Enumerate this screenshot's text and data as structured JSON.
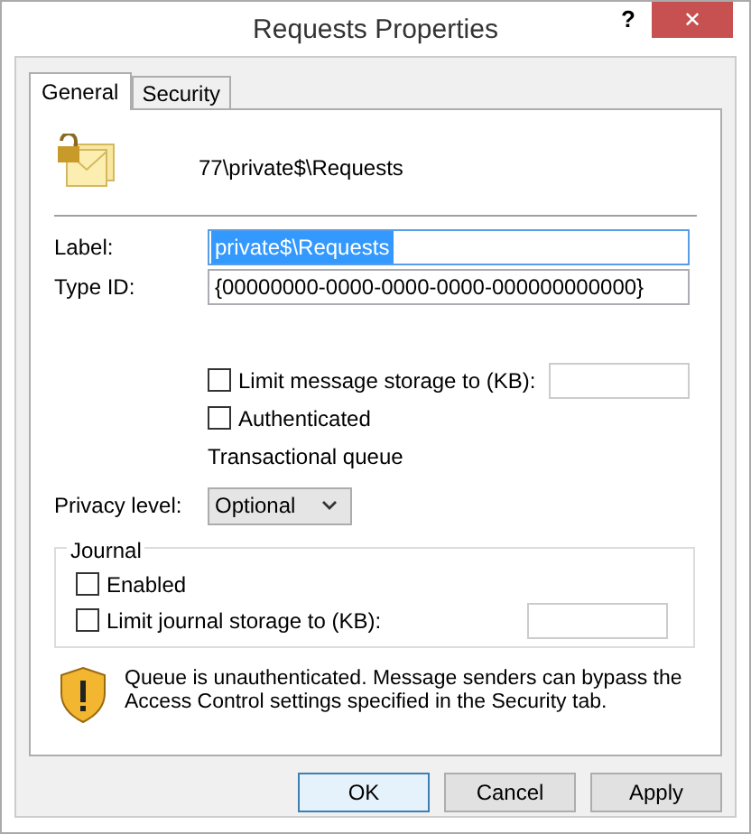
{
  "window": {
    "title": "Requests Properties",
    "help": "?",
    "close": "✕"
  },
  "tabs": [
    {
      "label": "General",
      "selected": true
    },
    {
      "label": "Security",
      "selected": false
    }
  ],
  "queue_path": "77\\private$\\Requests",
  "fields": [
    {
      "label": "Label:",
      "value": "private$\\Requests",
      "selected": true
    },
    {
      "label": "Type ID:",
      "value": "{00000000-0000-0000-0000-000000000000}",
      "selected": false
    }
  ],
  "limit_storage": {
    "label": "Limit message storage to (KB):",
    "checked": false
  },
  "authenticated": {
    "label": "Authenticated",
    "checked": false
  },
  "transactional": "Transactional queue",
  "privacy": {
    "label": "Privacy level:",
    "value": "Optional"
  },
  "journal": {
    "title": "Journal",
    "enabled": {
      "label": "Enabled",
      "checked": false
    },
    "limit": {
      "label": "Limit journal storage to (KB):",
      "checked": false
    }
  },
  "warning": "Queue is unauthenticated. Message senders can bypass the Access Control settings specified in the Security tab.",
  "buttons": [
    {
      "label": "OK",
      "default": true
    },
    {
      "label": "Cancel",
      "default": false
    },
    {
      "label": "Apply",
      "default": false
    }
  ]
}
